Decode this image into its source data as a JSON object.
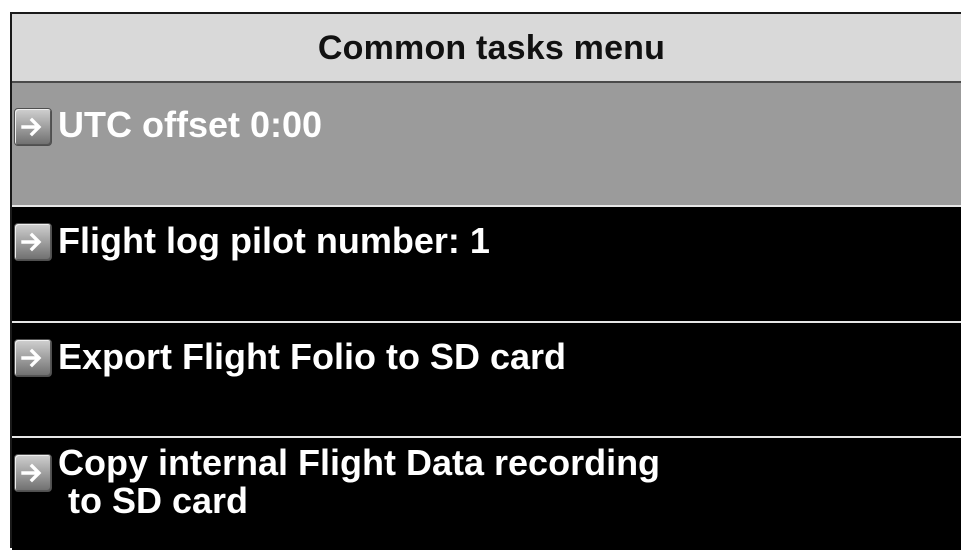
{
  "menu": {
    "title": "Common tasks menu",
    "items": [
      {
        "label": "UTC offset 0:00",
        "icon": "arrow-right-icon",
        "selected": true
      },
      {
        "label": "Flight log pilot number: 1",
        "icon": "arrow-right-icon",
        "selected": false
      },
      {
        "label": "Export Flight Folio to SD card",
        "icon": "arrow-right-icon",
        "selected": false
      },
      {
        "label": "Copy internal Flight Data recording\n to SD card",
        "icon": "arrow-right-icon",
        "selected": false
      }
    ]
  },
  "colors": {
    "title_bg": "#d9d9d9",
    "selected_bg": "#9b9b9b",
    "item_bg": "#000000",
    "text": "#ffffff",
    "divider": "#e6e6e6"
  }
}
